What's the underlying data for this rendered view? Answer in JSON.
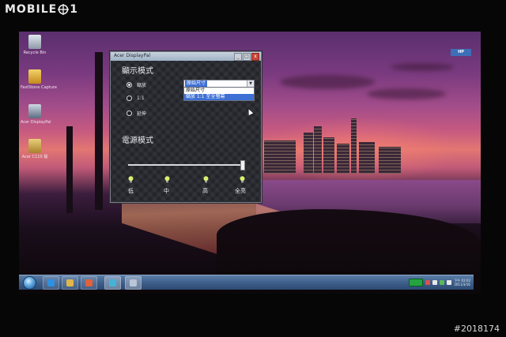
{
  "watermark": {
    "logo_text_left": "MOBILE",
    "logo_text_right": "1",
    "post_id": "#2018174"
  },
  "desktop": {
    "icons": [
      {
        "label": "Recycle Bin",
        "icon": "recycle-bin-icon"
      },
      {
        "label": "FastStone Capture",
        "icon": "faststone-capture-icon"
      },
      {
        "label": "Acer DisplayPal",
        "icon": "acer-displaypal-icon"
      },
      {
        "label": "Acer C110 檔",
        "icon": "folder-icon"
      }
    ],
    "corner_badge": "HP"
  },
  "window": {
    "title": "Acer DisplayPal",
    "controls": {
      "minimize": "_",
      "maximize": "□",
      "close": "x"
    },
    "display_mode": {
      "title": "顯示模式",
      "options": [
        {
          "label": "縮放",
          "selected": true
        },
        {
          "label": "1:1",
          "selected": false
        },
        {
          "label": "延伸",
          "selected": false
        }
      ],
      "combo_value": "原始尺寸",
      "dropdown_options": [
        {
          "label": "原始尺寸",
          "highlighted": false
        },
        {
          "label": "縮放 1:1 至全螢幕",
          "highlighted": true
        }
      ]
    },
    "power_mode": {
      "title": "電源模式",
      "slider_level": 1.0,
      "levels": [
        "低",
        "中",
        "高",
        "全亮"
      ]
    }
  },
  "taskbar": {
    "buttons": [
      "start-orb",
      "ie-icon",
      "explorer-icon",
      "media-player-icon",
      "network-icon",
      "displaypal-icon"
    ],
    "clock_time": "下午 03:02",
    "clock_date": "2011/3/16",
    "accent": "#3e5f8a"
  }
}
